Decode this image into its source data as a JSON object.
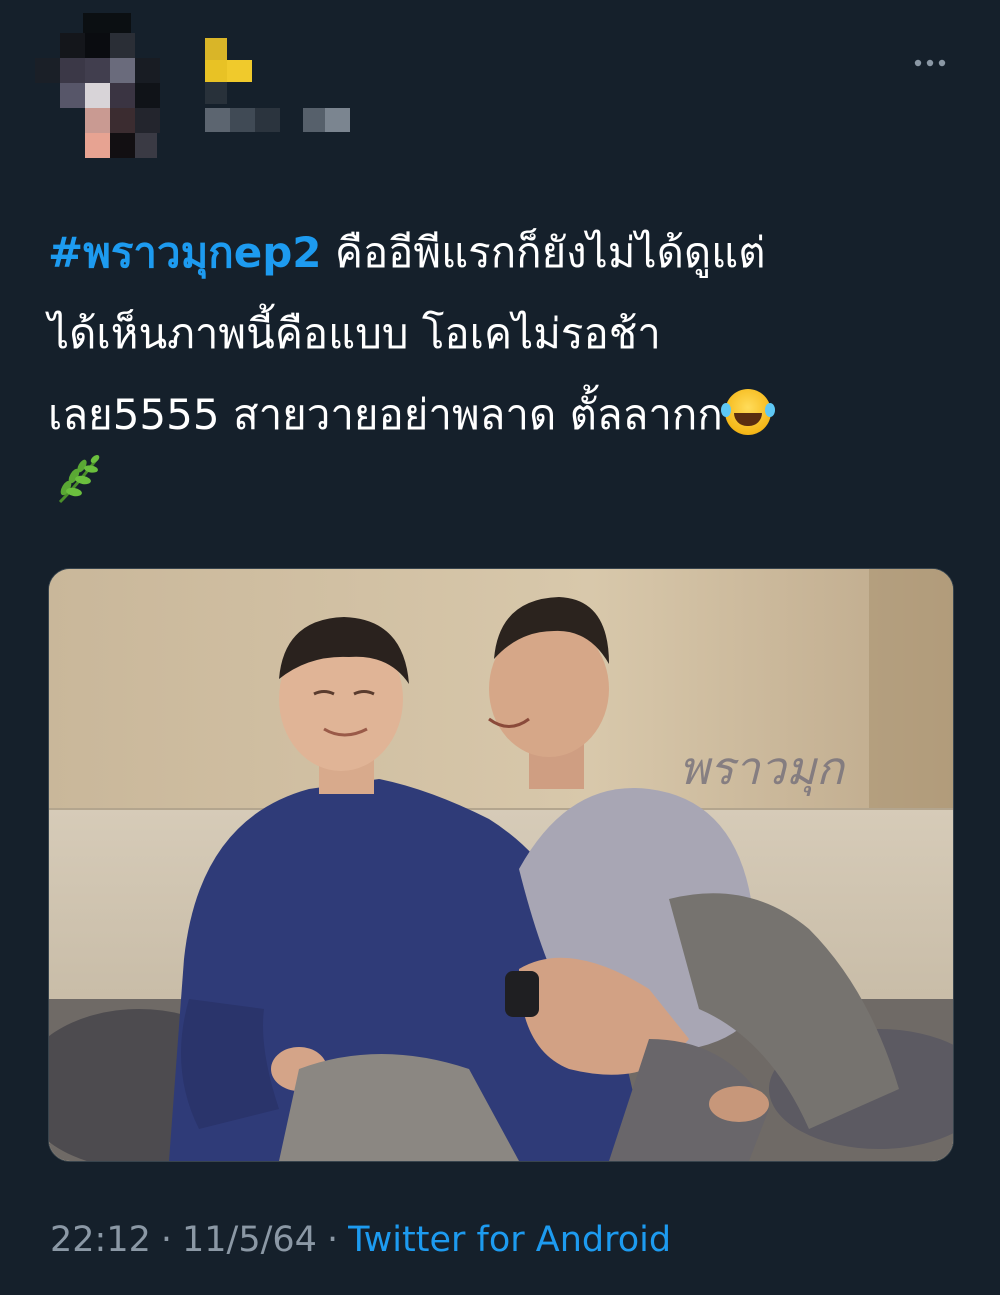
{
  "tweet": {
    "hashtag": "#พราวมุกep2",
    "line1_rest": " คืออีพีแรกก็ยังไม่ได้ดูแต่",
    "line2": "ได้เห็นภาพนี้คือแบบ โอเคไม่รอช้า",
    "line3": "เลย5555 สายวายอย่าพลาด ตั้ลลากก",
    "emoji_1": "laughing-with-tears-icon",
    "emoji_2": "herb-icon"
  },
  "media": {
    "watermark": "พราวมุก"
  },
  "footer": {
    "time": "22:12",
    "separator": "·",
    "date": "11/5/64",
    "source": "Twitter for Android"
  },
  "colors": {
    "background": "#15202b",
    "accent": "#1d9bf0",
    "secondary_text": "#8b98a5"
  },
  "header": {
    "more_icon": "more-options-icon",
    "avatar_state": "pixelated",
    "name_state": "pixelated"
  }
}
